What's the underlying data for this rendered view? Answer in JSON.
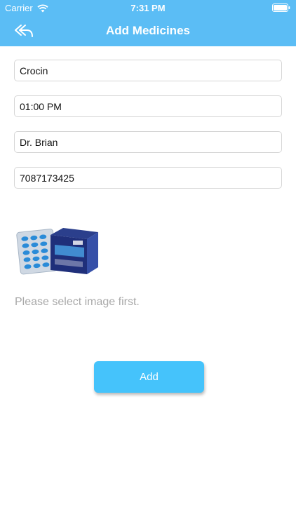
{
  "status_bar": {
    "carrier": "Carrier",
    "time": "7:31 PM",
    "icons": [
      "wifi-icon",
      "battery-icon"
    ]
  },
  "nav": {
    "title": "Add Medicines",
    "back_icon": "reply-arrow-icon"
  },
  "form": {
    "medicine_name": "Crocin",
    "time": "01:00 PM",
    "doctor": "Dr. Brian",
    "phone": "7087173425"
  },
  "image_hint": "Please select image first.",
  "add_button_label": "Add",
  "colors": {
    "header": "#5bbdf5",
    "button": "#45c3fb",
    "hint_text": "#a9a9a9",
    "field_border": "#d6d6d6"
  }
}
